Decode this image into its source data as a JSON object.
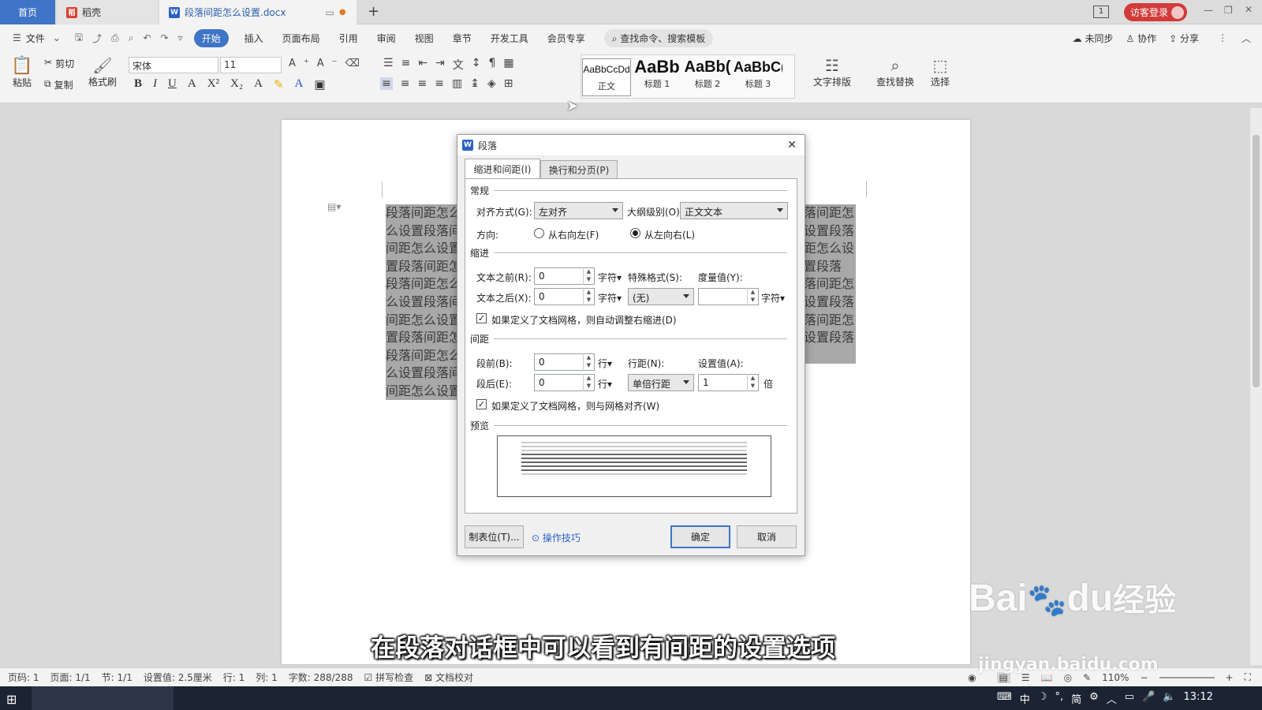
{
  "tabs": {
    "home": "首页",
    "shell": "稻壳",
    "document": "段落间距怎么设置.docx",
    "add": "+"
  },
  "titlebar": {
    "badge": "1",
    "login": "访客登录"
  },
  "menubar": {
    "file": "文件",
    "items": [
      "开始",
      "插入",
      "页面布局",
      "引用",
      "审阅",
      "视图",
      "章节",
      "开发工具",
      "会员专享"
    ],
    "search": "查找命令、搜索模板",
    "unsynced": "未同步",
    "collaborate": "协作",
    "share": "分享"
  },
  "ribbon": {
    "paste": "粘贴",
    "cut": "剪切",
    "copy": "复制",
    "format_painter": "格式刷",
    "font_name": "宋体",
    "font_size": "11",
    "styles": [
      {
        "preview": "AaBbCcDd",
        "label": "正文"
      },
      {
        "preview": "AaBb",
        "label": "标题 1"
      },
      {
        "preview": "AaBb(",
        "label": "标题 2"
      },
      {
        "preview": "AaBbC(",
        "label": "标题 3"
      }
    ],
    "text_layout": "文字排版",
    "find_replace": "查找替换",
    "select": "选择"
  },
  "document": {
    "left_lines": [
      "段落间距怎么",
      "么设置段落间",
      "间距怎么设置",
      "置段落间距怎",
      "段落间距怎么",
      "么设置段落间",
      "间距怎么设置",
      "置段落间距怎",
      "段落间距怎么",
      "么设置段落间",
      "间距怎么设置"
    ],
    "right_lines": [
      "落间距怎",
      "设置段落",
      "距怎么设",
      "置段落",
      "落间距怎",
      "设置段落",
      "",
      "",
      "落间距怎",
      "设置段落"
    ]
  },
  "dialog": {
    "title": "段落",
    "tab_indent": "缩进和间距(I)",
    "tab_break": "换行和分页(P)",
    "general": "常规",
    "alignment_label": "对齐方式(G):",
    "alignment_value": "左对齐",
    "outline_label": "大纲级别(O):",
    "outline_value": "正文文本",
    "direction_label": "方向:",
    "rtl": "从右向左(F)",
    "ltr": "从左向右(L)",
    "indent": "缩进",
    "before_text_label": "文本之前(R):",
    "before_text_value": "0",
    "after_text_label": "文本之后(X):",
    "after_text_value": "0",
    "unit_chars": "字符",
    "special_label": "特殊格式(S):",
    "special_value": "(无)",
    "measure_label": "度量值(Y):",
    "measure_value": "",
    "auto_indent": "如果定义了文档网格，则自动调整右缩进(D)",
    "spacing": "间距",
    "before_label": "段前(B):",
    "before_value": "0",
    "after_label": "段后(E):",
    "after_value": "0",
    "unit_line": "行",
    "line_spacing_label": "行距(N):",
    "line_spacing_value": "单倍行距",
    "set_value_label": "设置值(A):",
    "set_value": "1",
    "unit_times": "倍",
    "snap_grid": "如果定义了文档网格，则与网格对齐(W)",
    "preview": "预览",
    "tabs_button": "制表位(T)...",
    "tips": "操作技巧",
    "ok": "确定",
    "cancel": "取消"
  },
  "statusbar": {
    "page_num": "页码: 1",
    "pages": "页面: 1/1",
    "section": "节: 1/1",
    "setting": "设置值: 2.5厘米",
    "row": "行: 1",
    "col": "列: 1",
    "words": "字数: 288/288",
    "spellcheck": "拼写检查",
    "proofread": "文档校对",
    "zoom": "110%"
  },
  "taskbar": {
    "ime": "中",
    "simplified": "简",
    "time": "13:12"
  },
  "caption": "在段落对话框中可以看到有间距的设置选项",
  "watermark": {
    "brand": "Bai",
    "brand2": "du",
    "jingyan": "经验",
    "url": "jingyan.baidu.com"
  }
}
